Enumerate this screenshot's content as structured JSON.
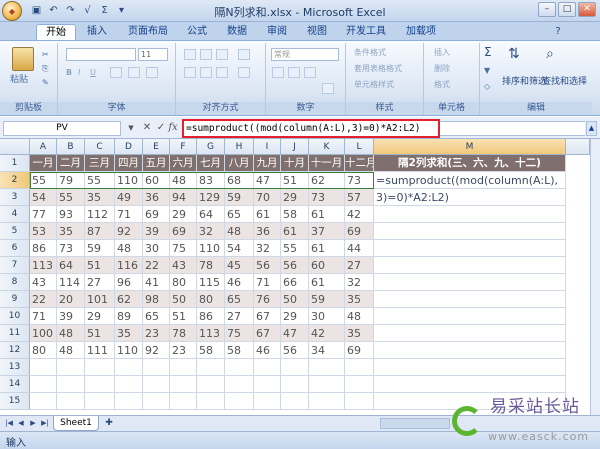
{
  "window": {
    "title": "隔N列求和.xlsx - Microsoft Excel",
    "office_button": "Office",
    "qat": [
      "save-icon",
      "undo-icon",
      "redo-icon",
      "check-icon",
      "sum-icon",
      "customize-icon"
    ]
  },
  "tabs": [
    "开始",
    "插入",
    "页面布局",
    "公式",
    "数据",
    "审阅",
    "视图",
    "开发工具",
    "加载项"
  ],
  "ribbon": {
    "clipboard": {
      "paste": "粘贴",
      "label": "剪贴板"
    },
    "font": {
      "size": "11",
      "label": "字体"
    },
    "align": {
      "label": "对齐方式"
    },
    "number": {
      "format": "常规",
      "label": "数字"
    },
    "styles": {
      "items": [
        "条件格式",
        "套用表格格式",
        "单元格样式"
      ],
      "label": "样式"
    },
    "cells": {
      "items": [
        "插入",
        "删除",
        "格式"
      ],
      "label": "单元格"
    },
    "edit": {
      "sort": "排序和筛选",
      "find": "查找和选择",
      "label": "编辑"
    }
  },
  "formula_bar": {
    "name_box": "PV",
    "formula": "=sumproduct((mod(column(A:L),3)=0)*A2:L2)"
  },
  "grid": {
    "columns": [
      "A",
      "B",
      "C",
      "D",
      "E",
      "F",
      "G",
      "H",
      "I",
      "J",
      "K",
      "L",
      "M"
    ],
    "rows": [
      "1",
      "2",
      "3",
      "4",
      "5",
      "6",
      "7",
      "8",
      "9",
      "10",
      "11",
      "12",
      "13",
      "14",
      "15"
    ],
    "header": [
      "一月",
      "二月",
      "三月",
      "四月",
      "五月",
      "六月",
      "七月",
      "八月",
      "九月",
      "十月",
      "十一月",
      "十二月",
      "隔2列求和(三、六、九、十二)"
    ],
    "data": [
      [
        55,
        79,
        55,
        110,
        60,
        48,
        83,
        68,
        47,
        51,
        62,
        73
      ],
      [
        54,
        55,
        35,
        49,
        36,
        94,
        129,
        59,
        70,
        29,
        73,
        57
      ],
      [
        77,
        93,
        112,
        71,
        69,
        29,
        64,
        65,
        61,
        58,
        61,
        42
      ],
      [
        53,
        35,
        87,
        92,
        39,
        69,
        32,
        48,
        36,
        61,
        37,
        69
      ],
      [
        86,
        73,
        59,
        48,
        30,
        75,
        110,
        54,
        32,
        55,
        61,
        44
      ],
      [
        113,
        64,
        51,
        116,
        22,
        43,
        78,
        45,
        56,
        56,
        60,
        27
      ],
      [
        43,
        114,
        27,
        96,
        41,
        80,
        115,
        46,
        71,
        66,
        61,
        32
      ],
      [
        22,
        20,
        101,
        62,
        98,
        50,
        80,
        65,
        76,
        50,
        59,
        35
      ],
      [
        71,
        39,
        29,
        89,
        65,
        51,
        86,
        27,
        67,
        29,
        30,
        48
      ],
      [
        100,
        48,
        51,
        35,
        23,
        78,
        113,
        75,
        67,
        47,
        42,
        35
      ],
      [
        80,
        48,
        111,
        110,
        92,
        23,
        58,
        58,
        46,
        56,
        34,
        69
      ]
    ],
    "m2_line1": "=sumproduct((mod(column(A:L),",
    "m2_line2": "3)=0)*A2:L2)"
  },
  "sheets": {
    "tab": "Sheet1"
  },
  "status": {
    "mode": "输入"
  },
  "watermark": {
    "name": "易采站长站",
    "url": "www.easck.com"
  }
}
